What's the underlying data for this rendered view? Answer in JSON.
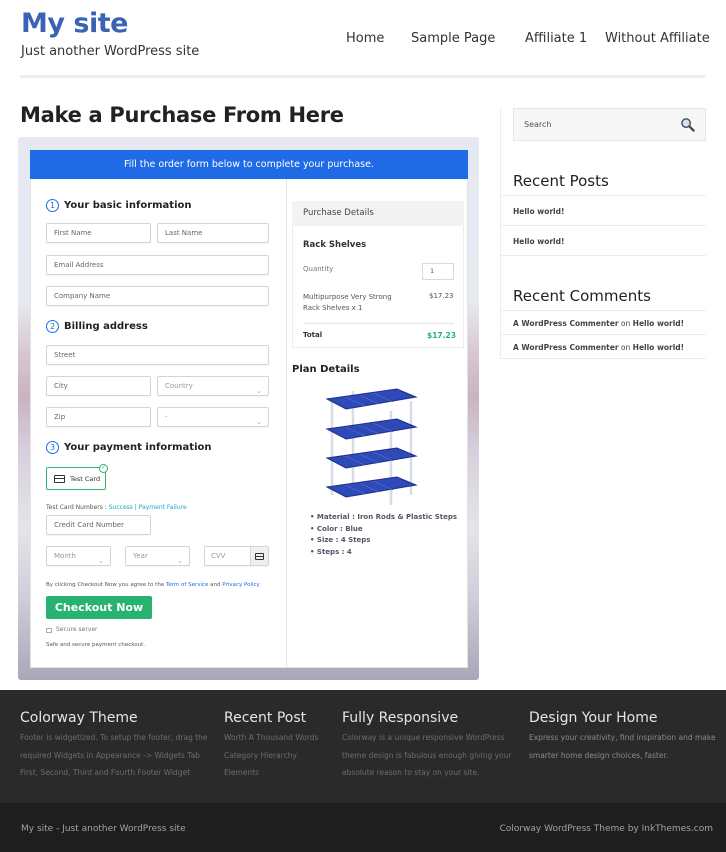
{
  "header": {
    "site_title": "My site",
    "tagline": "Just another WordPress site",
    "nav": [
      "Home",
      "Sample Page",
      "Affiliate 1",
      "Without Affiliate"
    ]
  },
  "page": {
    "title": "Make a Purchase From Here"
  },
  "checkout": {
    "banner": "Fill the order form below to complete your purchase.",
    "sections": {
      "basic": {
        "num": "1",
        "title": "Your basic information"
      },
      "billing": {
        "num": "2",
        "title": "Billing address"
      },
      "payment": {
        "num": "3",
        "title": "Your payment information"
      }
    },
    "placeholders": {
      "first_name": "First Name",
      "last_name": "Last Name",
      "email": "Email Address",
      "company": "Company Name",
      "street": "Street",
      "city": "City",
      "country": "Country",
      "zip": "Zip",
      "state": "-",
      "card_number": "Credit Card Number",
      "month": "Month",
      "year": "Year",
      "cvv": "CVV"
    },
    "payment_method": "Test Card",
    "test_numbers_label": "Test Card Numbers : ",
    "test_success": "Success",
    "test_separator": " | ",
    "test_failure": "Payment Failure",
    "agree_prefix": "By clicking Checkout Now you agree to the ",
    "terms": "Term of Service",
    "agree_and": " and ",
    "privacy": "Privacy Policy",
    "checkout_button": "Checkout Now",
    "secure_server": "Secure server",
    "safe_text": "Safe and secure payment checkout.",
    "colors": {
      "primary": "#1f6be6",
      "success": "#27b36f"
    }
  },
  "purchase_details": {
    "heading": "Purchase Details",
    "product": "Rack Shelves",
    "quantity_label": "Quantity",
    "quantity": "1",
    "line_item_1": "Multipurpose Very Strong",
    "line_item_2": "Rack Shelves x 1",
    "line_price": "$17.23",
    "total_label": "Total",
    "total": "$17.23"
  },
  "plan": {
    "title": "Plan Details",
    "specs": [
      "Material : Iron Rods & Plastic Steps",
      "Color : Blue",
      "Size : 4 Steps",
      "Steps : 4"
    ]
  },
  "sidebar": {
    "search_placeholder": "Search",
    "recent_posts_title": "Recent Posts",
    "recent_posts": [
      "Hello world!",
      "Hello world!"
    ],
    "recent_comments_title": "Recent Comments",
    "recent_comments": [
      {
        "author": "A WordPress Commenter",
        "on": " on ",
        "post": "Hello world!"
      },
      {
        "author": "A WordPress Commenter",
        "on": " on ",
        "post": "Hello world!"
      }
    ]
  },
  "footer": {
    "cols": [
      {
        "title": "Colorway Theme",
        "lines": [
          "Footer is widgetized. To setup the footer, drag the",
          "required Widgets in Appearance -> Widgets Tab",
          "First, Second, Third and Fourth Footer Widget"
        ]
      },
      {
        "title": "Recent Post",
        "lines": [
          "Worth A Thousand Words",
          "Category Hierarchy",
          "Elements"
        ]
      },
      {
        "title": "Fully Responsive",
        "lines": [
          "Colorway is a unique responsive WordPress",
          "theme design is fabulous enough giving your",
          "absolute reason to stay on your site."
        ]
      },
      {
        "title": "Design Your Home",
        "lines": [
          "Express your creativity, find inspiration and make",
          "smarter home design choices, faster."
        ]
      }
    ],
    "bottom_left": "My site - Just another WordPress site",
    "bottom_right": "Colorway WordPress Theme by InkThemes.com"
  }
}
